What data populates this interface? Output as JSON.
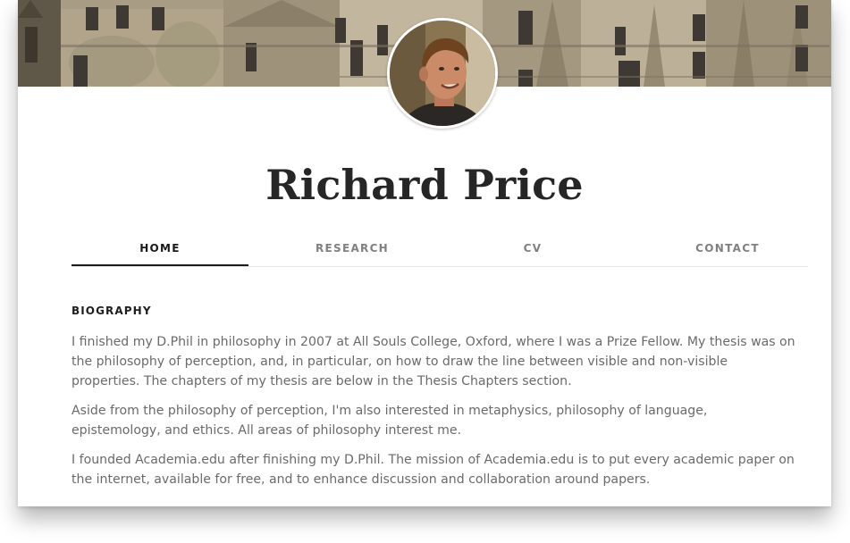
{
  "profile": {
    "name": "Richard Price",
    "avatar_icon": "profile-photo"
  },
  "nav": {
    "tabs": [
      {
        "label": "HOME",
        "active": true
      },
      {
        "label": "RESEARCH",
        "active": false
      },
      {
        "label": "CV",
        "active": false
      },
      {
        "label": "CONTACT",
        "active": false
      }
    ]
  },
  "main": {
    "section_title": "BIOGRAPHY",
    "paragraphs": [
      "I finished my D.Phil in philosophy in 2007 at All Souls College, Oxford, where I was a Prize Fellow. My thesis was on the philosophy of perception, and, in particular, on how to draw the line between visible and non-visible properties. The chapters of my thesis are below in the Thesis Chapters section.",
      "Aside from the philosophy of perception, I'm also interested in metaphysics, philosophy of language, epistemology, and ethics. All areas of philosophy interest me.",
      "I founded Academia.edu after finishing my D.Phil. The mission of Academia.edu is to put every academic paper on the internet, available for free, and to enhance discussion and collaboration around papers."
    ]
  },
  "colors": {
    "text_dark": "#262626",
    "text_body": "#6a6a6a",
    "tab_inactive": "#808080",
    "divider": "#e4e4e4"
  }
}
